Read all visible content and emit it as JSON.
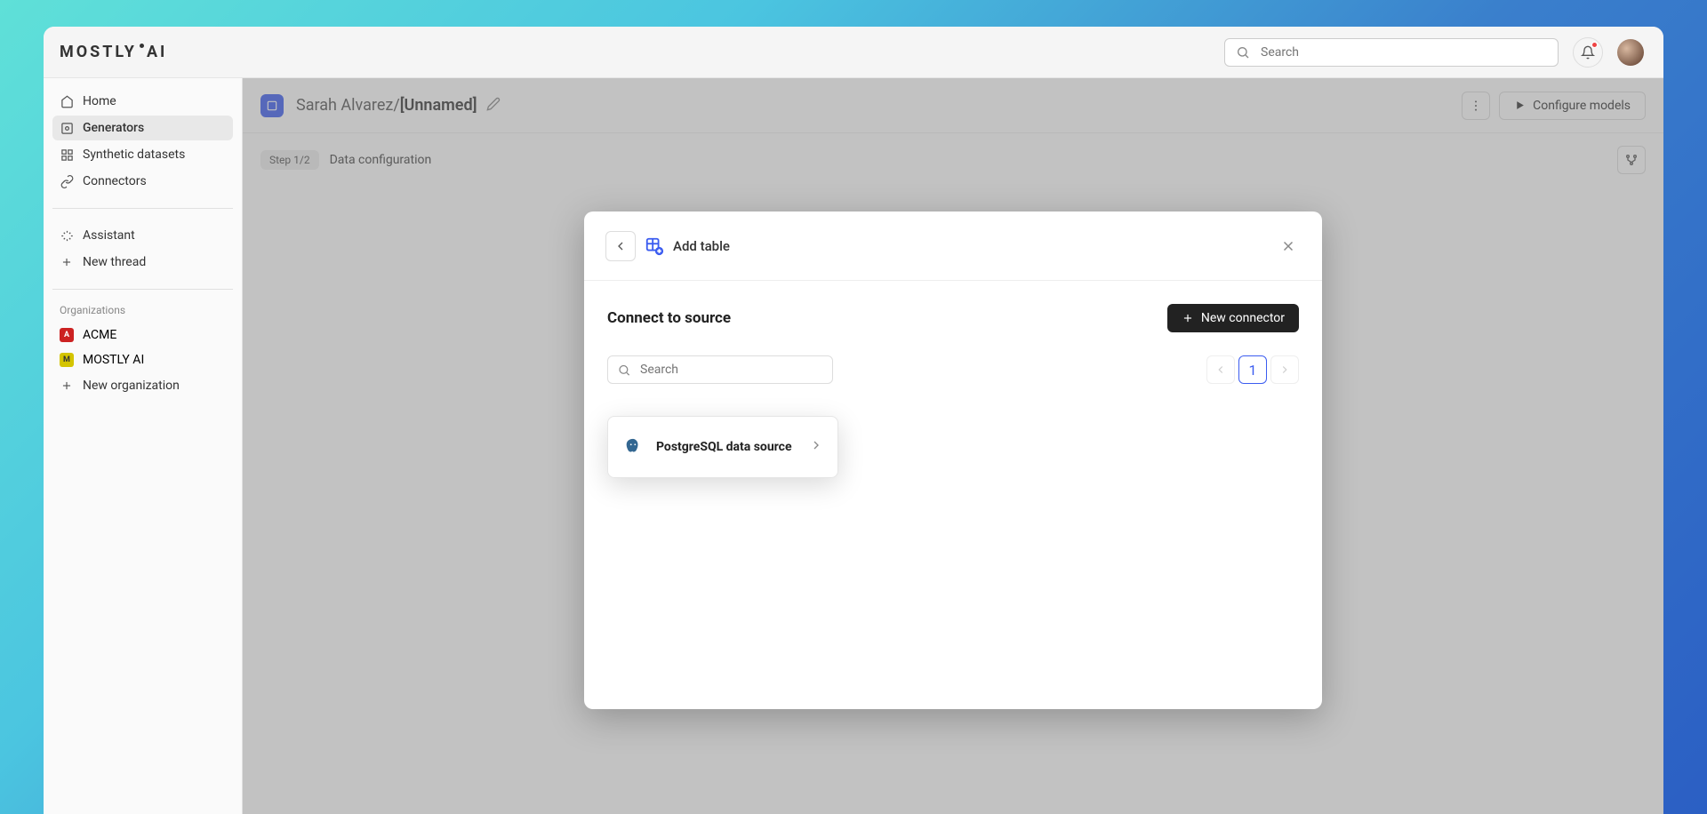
{
  "logo_text": "MOSTLY AI",
  "global_search_placeholder": "Search",
  "sidebar": {
    "nav": [
      {
        "label": "Home"
      },
      {
        "label": "Generators"
      },
      {
        "label": "Synthetic datasets"
      },
      {
        "label": "Connectors"
      }
    ],
    "assistant_label": "Assistant",
    "new_thread_label": "New thread",
    "orgs_label": "Organizations",
    "orgs": [
      {
        "label": "ACME"
      },
      {
        "label": "MOSTLY AI"
      }
    ],
    "new_org_label": "New organization"
  },
  "page": {
    "breadcrumb_owner": "Sarah Alvarez",
    "breadcrumb_name": "[Unnamed]",
    "configure_label": "Configure models",
    "step_badge": "Step 1/2",
    "step_label": "Data configuration"
  },
  "modal": {
    "title": "Add table",
    "section_title": "Connect to source",
    "new_connector_label": "New connector",
    "search_placeholder": "Search",
    "page_number": "1",
    "source_name": "PostgreSQL data source"
  }
}
